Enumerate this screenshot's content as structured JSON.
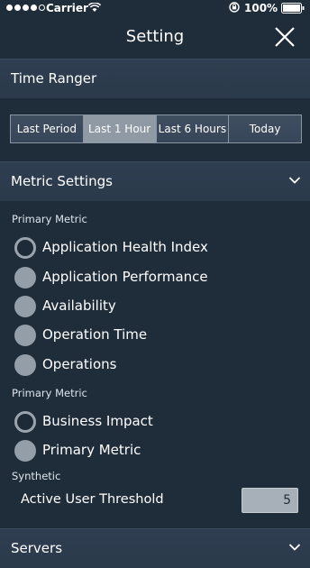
{
  "status_bar": {
    "carrier": "Carrier",
    "battery": "100%"
  },
  "nav": {
    "title": "Setting"
  },
  "time_range": {
    "title": "Time Ranger",
    "options": [
      "Last Period",
      "Last 1 Hour",
      "Last 6 Hours",
      "Today"
    ],
    "selected": "Last 1 Hour"
  },
  "metric_settings": {
    "title": "Metric Settings",
    "group1": {
      "label": "Primary Metric",
      "options": [
        "Application Health Index",
        "Application Performance",
        "Availability",
        "Operation Time",
        "Operations"
      ],
      "selected": "Application Health Index"
    },
    "group2": {
      "label": "Primary Metric",
      "options": [
        "Business Impact",
        "Primary Metric"
      ],
      "selected": "Business Impact"
    },
    "synthetic": {
      "label": "Synthetic",
      "threshold_label": "Active User Threshold",
      "threshold_value": "5"
    }
  },
  "servers": {
    "title": "Servers"
  },
  "colors": {
    "background": "#1f2c3a",
    "header": "#2e3e50",
    "selected_segment": "#8f9aa5"
  }
}
